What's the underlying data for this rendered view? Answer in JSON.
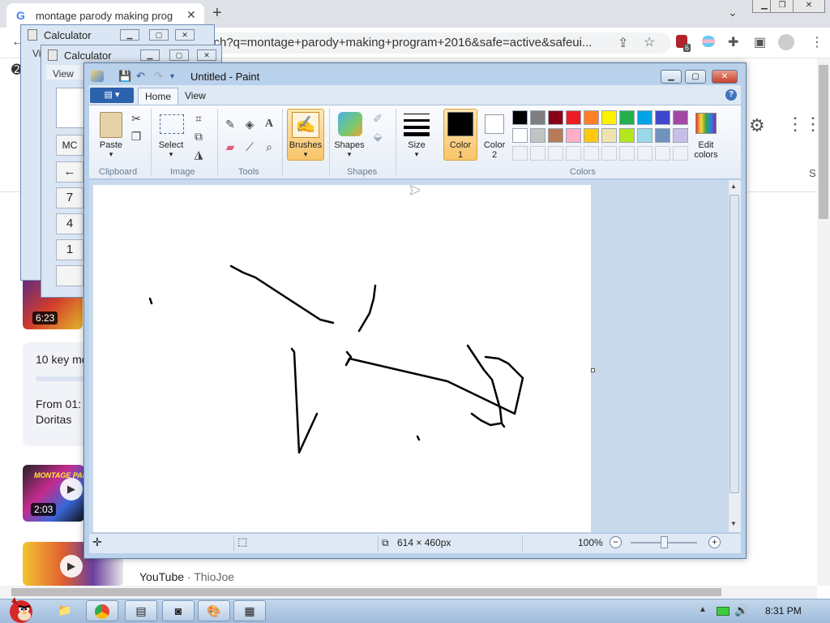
{
  "browser": {
    "tab_title": "montage parody making prog",
    "url": "sch?q=montage+parody+making+program+2016&safe=active&safeui...",
    "badge_count": "6"
  },
  "google": {
    "card_text_1": "10 key mo",
    "card_text_2": "From 01:",
    "card_text_3": "Doritas",
    "thumb1_duration": "6:23",
    "thumb2_duration": "2:03",
    "thumb2_caption": "MONTAGE PAR",
    "yt_source": "YouTube",
    "yt_channel": "ThioJoe",
    "right_cut_label": "S"
  },
  "calculator_back": {
    "title": "Calculator",
    "menu_view": "Vi"
  },
  "calculator_front": {
    "title": "Calculator",
    "menu_view": "View",
    "mc_label": "MC",
    "back_glyph": "←",
    "keys": [
      "7",
      "4",
      "1"
    ]
  },
  "paint": {
    "window_title": "Untitled - Paint",
    "tabs": [
      "Home",
      "View"
    ],
    "groups": {
      "clipboard": "Clipboard",
      "image": "Image",
      "tools": "Tools",
      "shapes": "Shapes",
      "colors": "Colors"
    },
    "buttons": {
      "paste": "Paste",
      "select": "Select",
      "brushes": "Brushes",
      "shapes": "Shapes",
      "size": "Size",
      "color1": "Color",
      "color1_num": "1",
      "color2": "Color",
      "color2_num": "2",
      "edit_colors_1": "Edit",
      "edit_colors_2": "colors"
    },
    "palette_row1": [
      "#000000",
      "#7f7f7f",
      "#880015",
      "#ed1c24",
      "#ff7f27",
      "#fff200",
      "#22b14c",
      "#00a2e8",
      "#3f48cc",
      "#a349a4"
    ],
    "palette_row2": [
      "#ffffff",
      "#c3c3c3",
      "#b97a57",
      "#ffaec9",
      "#ffc90e",
      "#efe4b0",
      "#b5e61d",
      "#99d9ea",
      "#7092be",
      "#c8bfe7"
    ],
    "canvas_size": "614 × 460px",
    "zoom": "100%"
  },
  "taskbar": {
    "clock": "8:31 PM"
  }
}
